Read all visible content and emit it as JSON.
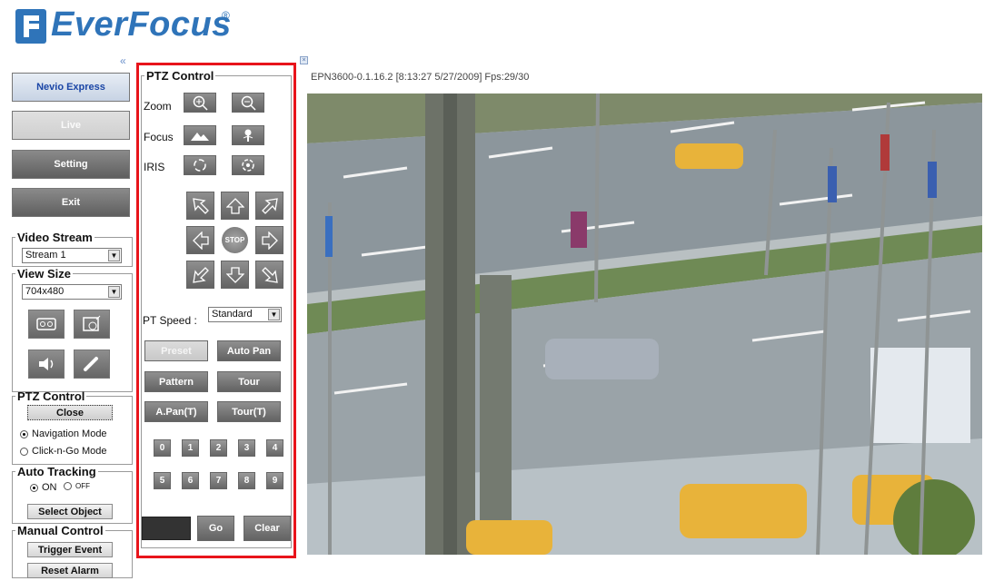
{
  "header": {
    "brand": "EverFocus",
    "registered_mark": "®"
  },
  "nav": {
    "collapse_glyph": "«",
    "nevio_express": "Nevio Express",
    "live": "Live",
    "setting": "Setting",
    "exit": "Exit"
  },
  "video_stream": {
    "legend": "Video Stream",
    "selected": "Stream 1"
  },
  "view_size": {
    "legend": "View Size",
    "selected": "704x480"
  },
  "ptz_left": {
    "legend": "PTZ Control",
    "close_label": "Close",
    "navigation_mode": "Navigation Mode",
    "click_n_go_mode": "Click-n-Go Mode",
    "selected_mode": "Navigation Mode"
  },
  "auto_tracking": {
    "legend": "Auto Tracking",
    "on_label": "ON",
    "off_label": "OFF",
    "selected": "ON",
    "select_object": "Select Object"
  },
  "manual_control": {
    "legend": "Manual Control",
    "trigger_event": "Trigger Event",
    "reset_alarm": "Reset Alarm"
  },
  "ptz_panel": {
    "legend": "PTZ Control",
    "zoom_label": "Zoom",
    "focus_label": "Focus",
    "iris_label": "IRIS",
    "stop_label": "STOP",
    "pt_speed_label": "PT Speed :",
    "pt_speed_value": "Standard",
    "modes": {
      "preset": "Preset",
      "auto_pan": "Auto Pan",
      "pattern": "Pattern",
      "tour": "Tour",
      "a_pan_t": "A.Pan(T)",
      "tour_t": "Tour(T)"
    },
    "active_mode": "Preset",
    "numbers": [
      "0",
      "1",
      "2",
      "3",
      "4",
      "5",
      "6",
      "7",
      "8",
      "9"
    ],
    "go_label": "Go",
    "clear_label": "Clear"
  },
  "video": {
    "status_text": "EPN3600-0.1.16.2 [8:13:27 5/27/2009] Fps:29/30"
  },
  "colors": {
    "brand_blue": "#2f74b9",
    "highlight_red": "#e8141b",
    "button_gray": "#6f6f6f"
  },
  "icons": {
    "zoom_in": "zoom-in-icon",
    "zoom_out": "zoom-out-icon",
    "focus_far": "focus-far-icon",
    "focus_near": "focus-near-icon",
    "iris_open": "iris-open-icon",
    "iris_close": "iris-close-icon",
    "record": "record-icon",
    "snapshot": "snapshot-icon",
    "speaker": "speaker-icon",
    "microphone": "microphone-icon"
  }
}
